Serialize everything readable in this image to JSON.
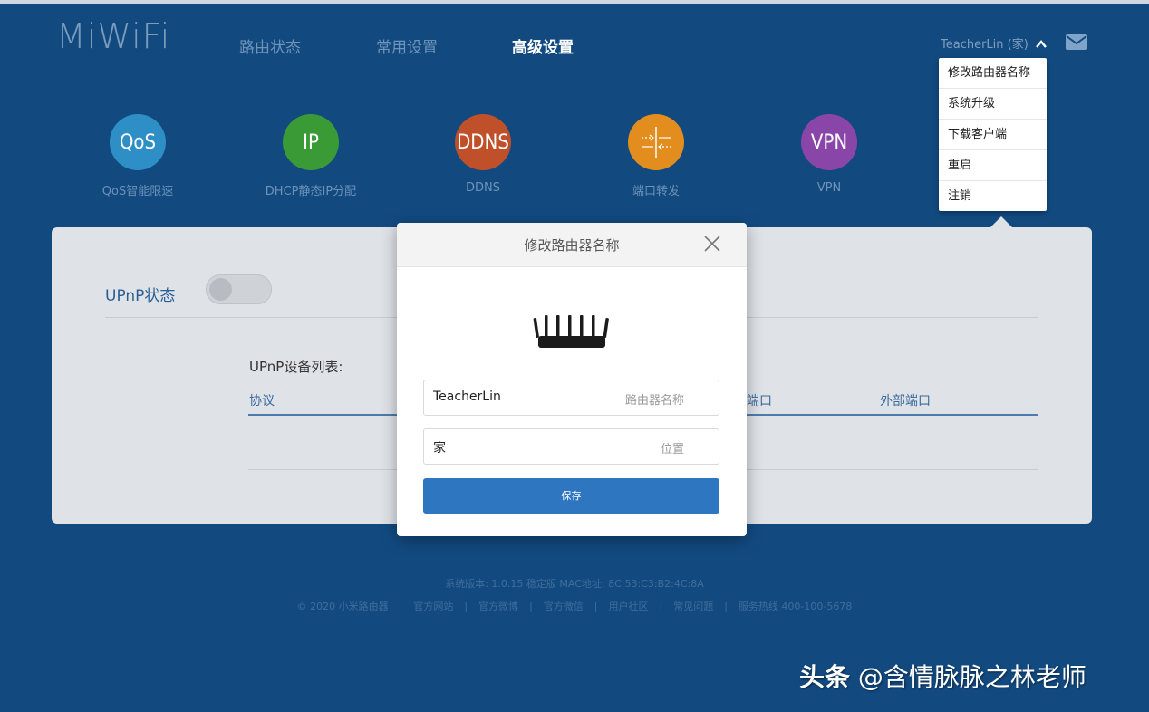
{
  "header": {
    "logo": "MiWiFi",
    "nav": [
      "路由状态",
      "常用设置",
      "高级设置"
    ],
    "active_nav": "高级设置",
    "user_label": "TeacherLin (家)",
    "chevron": "^"
  },
  "dropdown": {
    "items": [
      "修改路由器名称",
      "系统升级",
      "下载客户端",
      "重启",
      "注销"
    ]
  },
  "features": [
    {
      "icon_text": "QoS",
      "label": "QoS智能限速",
      "color": "#2e8fc7"
    },
    {
      "icon_text": "IP",
      "label": "DHCP静态IP分配",
      "color": "#3a9a35"
    },
    {
      "icon_text": "DDNS",
      "label": "DDNS",
      "color": "#c0502a"
    },
    {
      "icon_text": "",
      "label": "端口转发",
      "color": "#e38d1f",
      "icon": "port-forward-icon"
    },
    {
      "icon_text": "VPN",
      "label": "VPN",
      "color": "#8a45a8"
    }
  ],
  "upnp": {
    "label": "UPnP状态",
    "enabled": false,
    "list_title": "UPnP设备列表:",
    "columns": [
      "协议",
      "端口",
      "外部端口"
    ]
  },
  "modal": {
    "title": "修改路由器名称",
    "name_value": "TeacherLin",
    "name_placeholder": "路由器名称",
    "location_value": "家",
    "location_placeholder": "位置",
    "save_label": "保存"
  },
  "footer": {
    "version_line": "系统版本: 1.0.15 稳定版  MAC地址: 8C:53:C3:B2:4C:8A",
    "links": [
      "© 2020 小米路由器",
      "官方网站",
      "官方微博",
      "官方微信",
      "用户社区",
      "常见问题",
      "服务热线 400-100-5678"
    ],
    "separator": "|"
  },
  "watermark": {
    "strong": "头条",
    "text": " @含情脉脉之林老师"
  }
}
